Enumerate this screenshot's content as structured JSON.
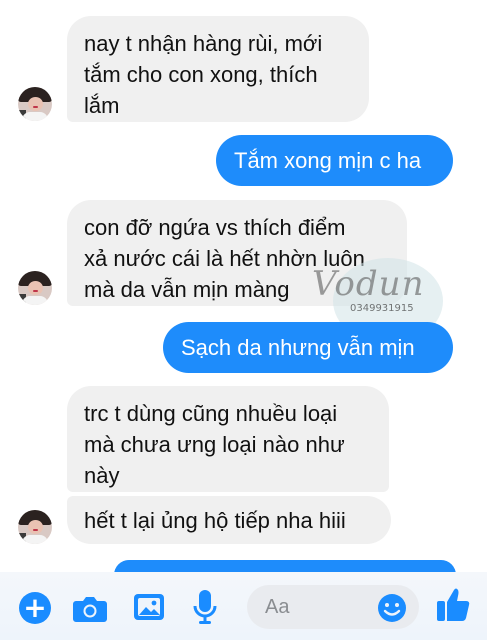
{
  "conversation": {
    "messages": [
      {
        "side": "incoming",
        "text": "nay t nhận hàng rùi, mới\ntắm cho con xong, thích\nlắm"
      },
      {
        "side": "outgoing",
        "text": "Tắm xong mịn c ha"
      },
      {
        "side": "incoming",
        "text": "con đỡ ngứa vs thích điểm\nxả nước cái là hết nhờn luôn\nmà da vẫn mịn màng"
      },
      {
        "side": "outgoing",
        "text": "Sạch da nhưng vẫn mịn"
      },
      {
        "side": "incoming",
        "text": "trc t dùng cũng nhuều loại\nmà chưa ưng loại nào như\nnày"
      },
      {
        "side": "incoming",
        "text": "hết t lại ủng hộ tiếp nha hiii"
      }
    ]
  },
  "watermark": {
    "signature": "Vodun",
    "phone": "0349931915"
  },
  "composer": {
    "placeholder": "Aa",
    "icons": [
      "plus-icon",
      "camera-icon",
      "gallery-icon",
      "microphone-icon",
      "emoji-icon",
      "thumbs-up-icon"
    ]
  },
  "colors": {
    "outgoing_bubble": "#1e8cfb",
    "incoming_bubble": "#f0f0f0",
    "accent": "#1a8cff"
  }
}
